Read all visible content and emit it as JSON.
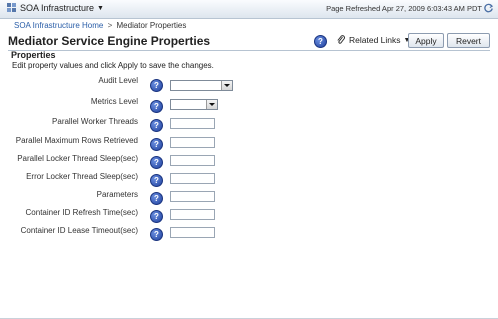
{
  "topbar": {
    "app_menu_label": "SOA Infrastructure",
    "refresh_text": "Page Refreshed Apr 27, 2009 6:03:43 AM PDT"
  },
  "breadcrumb": {
    "home": "SOA Infrastructure Home",
    "separator": ">",
    "current": "Mediator Properties"
  },
  "page": {
    "title": "Mediator Service Engine Properties"
  },
  "toolbar": {
    "related_links_label": "Related Links",
    "apply_label": "Apply",
    "revert_label": "Revert"
  },
  "section": {
    "title": "Properties",
    "instructions": "Edit property values and click Apply to save the changes."
  },
  "properties": [
    {
      "label": "Audit Level",
      "control": "select",
      "value": ""
    },
    {
      "label": "Metrics Level",
      "control": "select",
      "value": ""
    },
    {
      "label": "Parallel Worker Threads",
      "control": "text",
      "value": ""
    },
    {
      "label": "Parallel Maximum Rows Retrieved",
      "control": "text",
      "value": ""
    },
    {
      "label": "Parallel Locker Thread Sleep(sec)",
      "control": "text",
      "value": ""
    },
    {
      "label": "Error Locker Thread Sleep(sec)",
      "control": "text",
      "value": ""
    },
    {
      "label": "Parameters",
      "control": "text",
      "value": ""
    },
    {
      "label": "Container ID Refresh Time(sec)",
      "control": "text",
      "value": ""
    },
    {
      "label": "Container ID Lease Timeout(sec)",
      "control": "text",
      "value": ""
    }
  ],
  "icons": {
    "help": "help-icon",
    "refresh": "refresh-icon",
    "related_links": "paperclip-icon",
    "app": "soa-app-icon"
  },
  "colors": {
    "link": "#2a5ea8",
    "help_blue": "#1e3f9c",
    "header_bg": "#dde5ee"
  }
}
